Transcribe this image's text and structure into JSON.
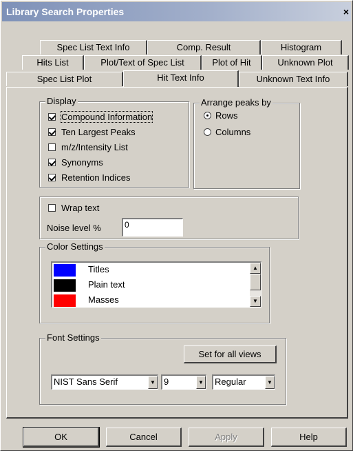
{
  "window": {
    "title": "Library Search Properties",
    "close_glyph": "×"
  },
  "tabs": {
    "row1": [
      "Spec List Text Info",
      "Comp. Result",
      "Histogram"
    ],
    "row2": [
      "Hits List",
      "Plot/Text of Spec List",
      "Plot of Hit",
      "Unknown Plot"
    ],
    "row3": [
      "Spec List Plot",
      "Hit Text Info",
      "Unknown Text Info"
    ],
    "active": "Hit Text Info"
  },
  "display": {
    "label": "Display",
    "items": [
      {
        "label": "Compound Information",
        "checked": true
      },
      {
        "label": "Ten Largest Peaks",
        "checked": true
      },
      {
        "label": "m/z/Intensity List",
        "checked": false
      },
      {
        "label": "Synonyms",
        "checked": true
      },
      {
        "label": "Retention Indices",
        "checked": true
      }
    ]
  },
  "arrange": {
    "label": "Arrange peaks by",
    "options": [
      {
        "label": "Rows",
        "selected": true
      },
      {
        "label": "Columns",
        "selected": false
      }
    ]
  },
  "options": {
    "wrap_label": "Wrap text",
    "wrap_checked": false,
    "noise_label": "Noise level %",
    "noise_value": "0"
  },
  "colors": {
    "label": "Color Settings",
    "items": [
      {
        "label": "Titles",
        "color": "#0000ff"
      },
      {
        "label": "Plain text",
        "color": "#000000"
      },
      {
        "label": "Masses",
        "color": "#ff0000"
      }
    ],
    "scroll_up": "▲",
    "scroll_down": "▼"
  },
  "fonts": {
    "label": "Font Settings",
    "set_all_label": "Set for all views",
    "font_name": "NIST Sans Serif",
    "font_size": "9",
    "font_style": "Regular",
    "dropdown_glyph": "▼"
  },
  "buttons": {
    "ok": "OK",
    "cancel": "Cancel",
    "apply": "Apply",
    "help": "Help"
  }
}
